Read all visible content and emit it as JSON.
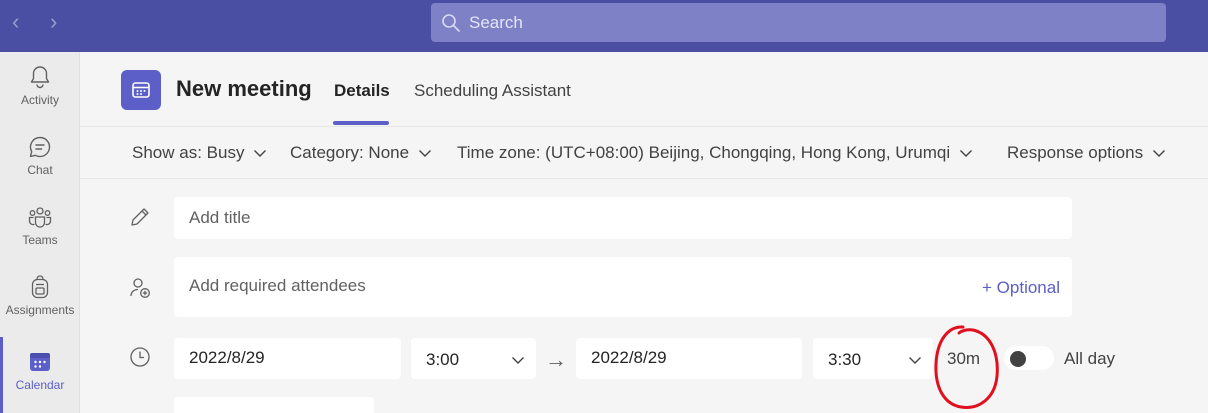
{
  "topbar": {
    "search_placeholder": "Search"
  },
  "rail": {
    "items": [
      {
        "label": "Activity",
        "icon": "bell-icon"
      },
      {
        "label": "Chat",
        "icon": "chat-icon"
      },
      {
        "label": "Teams",
        "icon": "teams-icon"
      },
      {
        "label": "Assignments",
        "icon": "backpack-icon"
      },
      {
        "label": "Calendar",
        "icon": "calendar-icon",
        "active": true
      }
    ]
  },
  "header": {
    "title": "New meeting",
    "tabs": [
      {
        "label": "Details",
        "active": true
      },
      {
        "label": "Scheduling Assistant",
        "active": false
      }
    ]
  },
  "options": {
    "show_as": "Show as: Busy",
    "category": "Category: None",
    "time_zone": "Time zone: (UTC+08:00) Beijing, Chongqing, Hong Kong, Urumqi",
    "response": "Response options"
  },
  "form": {
    "title_placeholder": "Add title",
    "attendees_placeholder": "Add required attendees",
    "optional_link": "+ Optional",
    "start_date": "2022/8/29",
    "start_time": "3:00",
    "end_date": "2022/8/29",
    "end_time": "3:30",
    "duration": "30m",
    "all_day_label": "All day",
    "all_day": false
  },
  "colors": {
    "topbar": "#4b4fa3",
    "accent": "#5b5fc7",
    "annotation": "#e0101e"
  }
}
